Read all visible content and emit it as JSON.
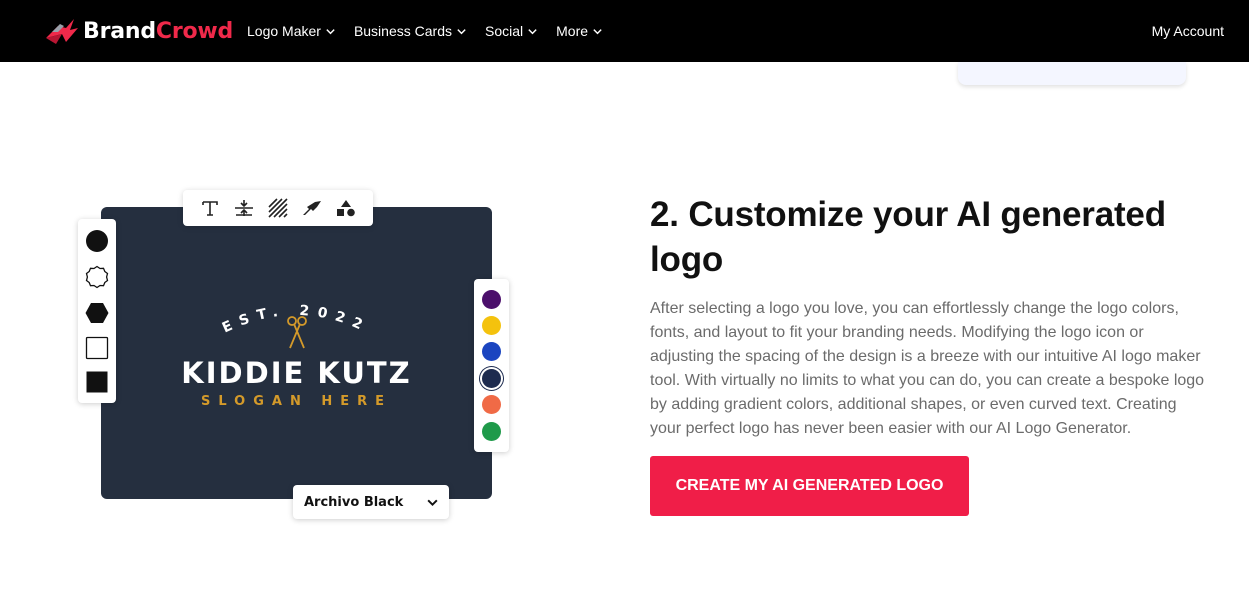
{
  "nav": {
    "brand_part1": "Brand",
    "brand_part2": "Crowd",
    "items": [
      {
        "label": "Logo Maker"
      },
      {
        "label": "Business Cards"
      },
      {
        "label": "Social"
      },
      {
        "label": "More"
      }
    ],
    "account": "My Account"
  },
  "editor": {
    "tools": [
      "text-icon",
      "spacing-icon",
      "texture-icon",
      "effects-icon",
      "shapes-icon"
    ],
    "shapes": [
      "circle-filled",
      "badge-outline",
      "hexagon-filled",
      "square-outline",
      "square-filled"
    ],
    "colors": [
      "#4b0f6b",
      "#f4c20d",
      "#1b45c0",
      "#1d2b4f",
      "#f06a46",
      "#1f9a4a"
    ],
    "selected_color": "#1d2b4f",
    "logo": {
      "est": "EST. 2022",
      "name": "KIDDIE KUTZ",
      "slogan": "SLOGAN HERE"
    },
    "font_selected": "Archivo Black"
  },
  "section": {
    "heading": "2. Customize your AI generated logo",
    "body": "After selecting a logo you love, you can effortlessly change the logo colors, fonts, and layout to fit your branding needs. Modifying the logo icon or adjusting the spacing of the design is a breeze with our intuitive AI logo maker tool. With virtually no limits to what you can do, you can create a bespoke logo by adding gradient colors, additional shapes, or even curved text. Creating your perfect logo has never been easier with our AI Logo Generator.",
    "cta": "CREATE MY AI GENERATED LOGO"
  },
  "theme": {
    "accent": "#f01e48",
    "canvas_bg": "#252f3f",
    "slogan_color": "#d49a2a"
  }
}
